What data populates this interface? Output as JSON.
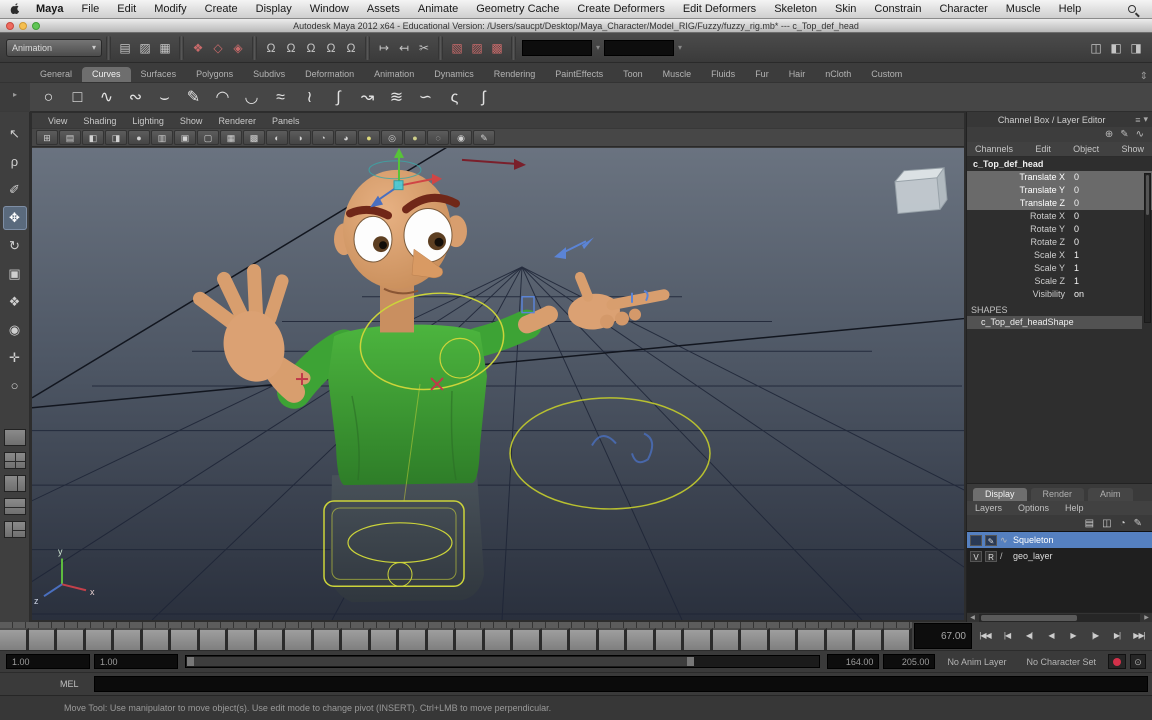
{
  "colors": {
    "viewport_top": "#6a7380",
    "viewport_bottom": "#2a303d",
    "grid_line": "#1d2436",
    "skin": "#d89e6e",
    "shirt_green": "#3da335",
    "rig_yellow": "#ccd43a",
    "selection_blue": "#5580c0"
  },
  "menubar": {
    "items": [
      "Maya",
      "File",
      "Edit",
      "Modify",
      "Create",
      "Display",
      "Window",
      "Assets",
      "Animate",
      "Geometry Cache",
      "Create Deformers",
      "Edit Deformers",
      "Skeleton",
      "Skin",
      "Constrain",
      "Character",
      "Muscle",
      "Help"
    ]
  },
  "titlebar": {
    "title": "Autodesk Maya 2012 x64 - Educational Version: /Users/saucpt/Desktop/Maya_Character/Model_RIG/Fuzzy/fuzzy_rig.mb* --- c_Top_def_head"
  },
  "ui": {
    "caret": "▾",
    "updown": "⇕",
    "hamburger": "≡",
    "side_arrow_1": "▾",
    "side_arrow_2": "▸",
    "left_arrow": "◀",
    "right_arrow": "▶",
    "pref_glyph": "⊙",
    "cb_mini_1": "≡",
    "cb_mini_2": "▾"
  },
  "statusline": {
    "menuset": "Animation",
    "file_icons": [
      {
        "name": "new-scene-icon",
        "glyph": "▤"
      },
      {
        "name": "open-scene-icon",
        "glyph": "▨"
      },
      {
        "name": "save-scene-icon",
        "glyph": "▦"
      }
    ],
    "select_icons": [
      {
        "name": "select-hierarchy-icon",
        "glyph": "❖"
      },
      {
        "name": "select-object-icon",
        "glyph": "◇"
      },
      {
        "name": "select-component-icon",
        "glyph": "◈"
      }
    ],
    "snap_icons": [
      {
        "name": "snap-grid-icon",
        "glyph": "Ω"
      },
      {
        "name": "snap-curve-icon",
        "glyph": "Ω"
      },
      {
        "name": "snap-point-icon",
        "glyph": "Ω"
      },
      {
        "name": "snap-projected-center-icon",
        "glyph": "Ω"
      },
      {
        "name": "snap-view-plane-icon",
        "glyph": "Ω"
      }
    ],
    "history_icons": [
      {
        "name": "input-connections-icon",
        "glyph": "↦"
      },
      {
        "name": "output-connections-icon",
        "glyph": "↤"
      },
      {
        "name": "construction-history-icon",
        "glyph": "✂"
      }
    ],
    "render_icons": [
      {
        "name": "render-current-frame-icon",
        "glyph": "▧"
      },
      {
        "name": "ipr-render-icon",
        "glyph": "▨"
      },
      {
        "name": "render-settings-icon",
        "glyph": "▩"
      }
    ],
    "sidebar_toggles": [
      {
        "name": "toggle-attribute-editor-icon",
        "glyph": "◫"
      },
      {
        "name": "toggle-tool-settings-icon",
        "glyph": "◧"
      },
      {
        "name": "toggle-channel-box-icon",
        "glyph": "◨"
      }
    ]
  },
  "shelf": {
    "tabs": [
      {
        "label": "General"
      },
      {
        "label": "Curves",
        "active": true
      },
      {
        "label": "Surfaces"
      },
      {
        "label": "Polygons"
      },
      {
        "label": "Subdivs"
      },
      {
        "label": "Deformation"
      },
      {
        "label": "Animation"
      },
      {
        "label": "Dynamics"
      },
      {
        "label": "Rendering"
      },
      {
        "label": "PaintEffects"
      },
      {
        "label": "Toon"
      },
      {
        "label": "Muscle"
      },
      {
        "label": "Fluids"
      },
      {
        "label": "Fur"
      },
      {
        "label": "Hair"
      },
      {
        "label": "nCloth"
      },
      {
        "label": "Custom"
      }
    ],
    "icons": [
      {
        "name": "nurbs-circle-icon",
        "glyph": "○"
      },
      {
        "name": "nurbs-square-icon",
        "glyph": "□"
      },
      {
        "name": "cv-curve-tool-icon",
        "glyph": "∿"
      },
      {
        "name": "ep-curve-tool-icon",
        "glyph": "∾"
      },
      {
        "name": "bezier-curve-tool-icon",
        "glyph": "⌣"
      },
      {
        "name": "pencil-curve-tool-icon",
        "glyph": "✎"
      },
      {
        "name": "three-point-arc-icon",
        "glyph": "◠"
      },
      {
        "name": "two-point-arc-icon",
        "glyph": "◡"
      },
      {
        "name": "attach-curves-icon",
        "glyph": "≈"
      },
      {
        "name": "detach-curves-icon",
        "glyph": "≀"
      },
      {
        "name": "insert-knot-icon",
        "glyph": "∫"
      },
      {
        "name": "extend-curve-icon",
        "glyph": "↝"
      },
      {
        "name": "offset-curve-icon",
        "glyph": "≋"
      },
      {
        "name": "rebuild-curve-icon",
        "glyph": "∽"
      },
      {
        "name": "curve-fillet-icon",
        "glyph": "ς"
      },
      {
        "name": "add-points-tool-icon",
        "glyph": "ʃ"
      }
    ]
  },
  "toolbox": {
    "tools": [
      {
        "name": "select-tool",
        "glyph": "↖"
      },
      {
        "name": "lasso-select-tool",
        "glyph": "ρ"
      },
      {
        "name": "paint-select-tool",
        "glyph": "✐"
      },
      {
        "name": "move-tool",
        "glyph": "✥",
        "active": true
      },
      {
        "name": "rotate-tool",
        "glyph": "↻"
      },
      {
        "name": "scale-tool",
        "glyph": "▣"
      },
      {
        "name": "universal-manipulator-tool",
        "glyph": "❖"
      },
      {
        "name": "soft-modification-tool",
        "glyph": "◉"
      },
      {
        "name": "show-manipulator-tool",
        "glyph": "✛"
      },
      {
        "name": "last-tool-used",
        "glyph": "○"
      }
    ],
    "layouts": [
      {
        "name": "layout-single-perspective",
        "variant": "v-single"
      },
      {
        "name": "layout-four-view",
        "variant": "v-four"
      },
      {
        "name": "layout-persp-outliner",
        "variant": "v-lr"
      },
      {
        "name": "layout-persp-graph",
        "variant": "v-tb"
      },
      {
        "name": "layout-persp-hypershade",
        "variant": "v-mix"
      }
    ]
  },
  "viewport": {
    "menus": [
      "View",
      "Shading",
      "Lighting",
      "Show",
      "Renderer",
      "Panels"
    ],
    "icons": [
      {
        "name": "select-camera-icon",
        "glyph": "⊞"
      },
      {
        "name": "lock-camera-icon",
        "glyph": "▤"
      },
      {
        "name": "camera-attributes-icon",
        "glyph": "◧"
      },
      {
        "name": "bookmarks-icon",
        "glyph": "◨"
      },
      {
        "name": "image-plane-icon",
        "glyph": "●"
      },
      {
        "name": "2d-pan-zoom-icon",
        "glyph": "▥"
      },
      {
        "name": "oversampling-icon",
        "glyph": "▣"
      },
      {
        "name": "wireframe-icon",
        "glyph": "▢"
      },
      {
        "name": "smooth-shade-icon",
        "glyph": "▦"
      },
      {
        "name": "textured-icon",
        "glyph": "▩"
      },
      {
        "name": "use-lighting-icon",
        "glyph": "◐"
      },
      {
        "name": "shadows-icon",
        "glyph": "◑"
      },
      {
        "name": "ssao-icon",
        "glyph": "◔"
      },
      {
        "name": "motion-blur-icon",
        "glyph": "◕"
      },
      {
        "name": "default-light-icon",
        "glyph": "●",
        "color": "#ddd97a"
      },
      {
        "name": "silhouette-icon",
        "glyph": "◎"
      },
      {
        "name": "all-lights-icon",
        "glyph": "●",
        "color": "#cfcf8a"
      },
      {
        "name": "xray-icon",
        "glyph": "◌"
      },
      {
        "name": "isolate-select-icon",
        "glyph": "◉"
      },
      {
        "name": "grease-pencil-icon",
        "glyph": "✎"
      }
    ],
    "axis": {
      "x": "x",
      "y": "y",
      "z": "z"
    }
  },
  "channel_box": {
    "title": "Channel Box / Layer Editor",
    "mini_icons": [
      {
        "name": "channel-speed-icon",
        "glyph": "⊕"
      },
      {
        "name": "channel-manip-icon",
        "glyph": "✎"
      },
      {
        "name": "channel-graph-icon",
        "glyph": "∿"
      }
    ],
    "menus": [
      "Channels",
      "Edit",
      "Object",
      "Show"
    ],
    "object_name": "c_Top_def_head",
    "attributes": [
      {
        "name": "Translate X",
        "value": "0",
        "selected": true
      },
      {
        "name": "Translate Y",
        "value": "0",
        "selected": true
      },
      {
        "name": "Translate Z",
        "value": "0",
        "selected": true
      },
      {
        "name": "Rotate X",
        "value": "0",
        "selected": false
      },
      {
        "name": "Rotate Y",
        "value": "0",
        "selected": false
      },
      {
        "name": "Rotate Z",
        "value": "0",
        "selected": false
      },
      {
        "name": "Scale X",
        "value": "1",
        "selected": false
      },
      {
        "name": "Scale Y",
        "value": "1",
        "selected": false
      },
      {
        "name": "Scale Z",
        "value": "1",
        "selected": false
      },
      {
        "name": "Visibility",
        "value": "on",
        "selected": false
      }
    ],
    "shapes_header": "SHAPES",
    "shape_name": "c_Top_def_headShape"
  },
  "layer_editor": {
    "tabs": [
      {
        "label": "Display",
        "active": true
      },
      {
        "label": "Render"
      },
      {
        "label": "Anim"
      }
    ],
    "menus": [
      "Layers",
      "Options",
      "Help"
    ],
    "icons": [
      {
        "name": "new-empty-layer-icon",
        "glyph": "▤"
      },
      {
        "name": "new-layer-from-selected-icon",
        "glyph": "◫"
      },
      {
        "name": "sphere-layer-icon",
        "glyph": "◔"
      },
      {
        "name": "edit-layer-icon",
        "glyph": "✎"
      }
    ],
    "layers": [
      {
        "name": "Squeleton",
        "selected": true,
        "v": "",
        "r": "✎",
        "curve": "∿"
      },
      {
        "name": "geo_layer",
        "selected": false,
        "v": "V",
        "r": "R",
        "curve": "/"
      }
    ]
  },
  "timeline": {
    "current_frame": "67.00",
    "tick_count": 32,
    "playback": [
      {
        "name": "go-to-start-button",
        "glyph": "|◀◀"
      },
      {
        "name": "step-back-key-button",
        "glyph": "|◀"
      },
      {
        "name": "step-back-frame-button",
        "glyph": "◀|"
      },
      {
        "name": "play-backwards-button",
        "glyph": "◀"
      },
      {
        "name": "play-forwards-button",
        "glyph": "▶"
      },
      {
        "name": "step-forward-frame-button",
        "glyph": "|▶"
      },
      {
        "name": "step-forward-key-button",
        "glyph": "▶|"
      },
      {
        "name": "go-to-end-button",
        "glyph": "▶▶|"
      }
    ]
  },
  "range": {
    "start": "1.00",
    "playback_start": "1.00",
    "playback_end": "164.00",
    "end": "205.00",
    "anim_layer_label": "No Anim Layer",
    "character_set_label": "No Character Set"
  },
  "command_line": {
    "label": "MEL",
    "value": ""
  },
  "help_line": {
    "text": "Move Tool: Use manipulator to move object(s). Use edit mode to change pivot (INSERT). Ctrl+LMB to move perpendicular."
  }
}
